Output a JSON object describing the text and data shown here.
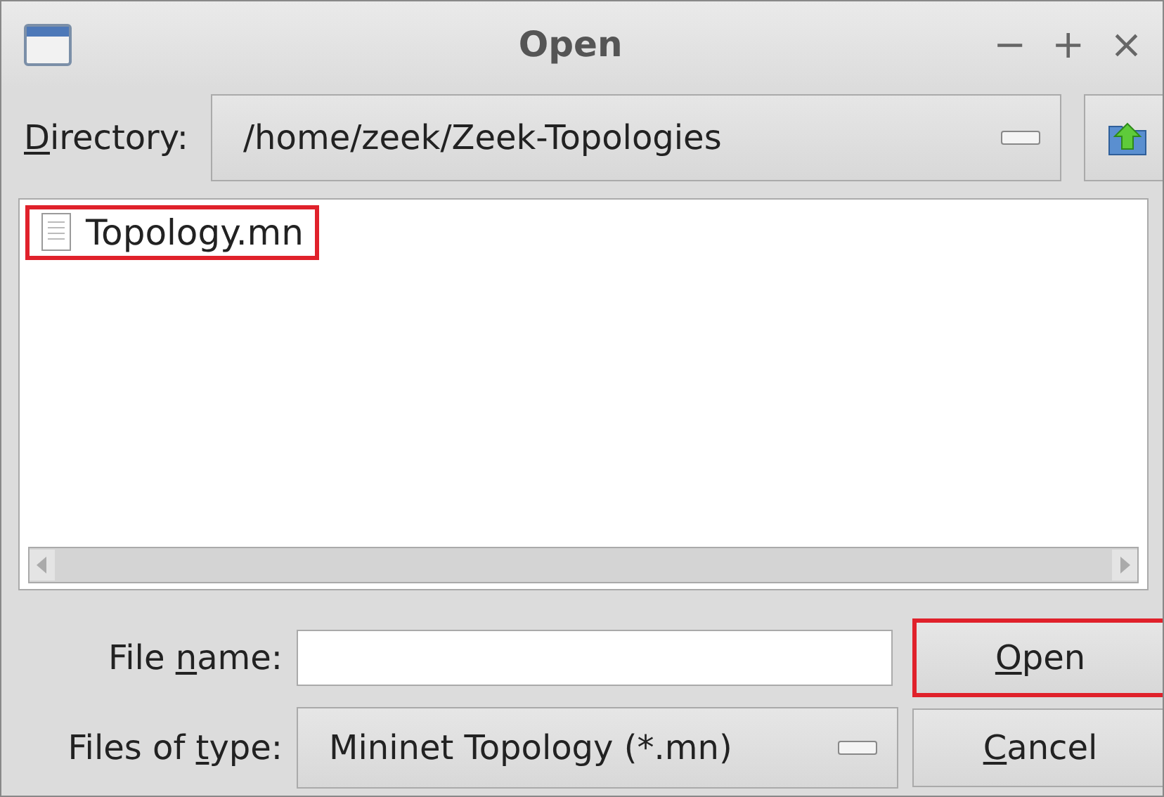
{
  "window": {
    "title": "Open",
    "controls": [
      "−",
      "+",
      "×"
    ]
  },
  "directory": {
    "label": [
      {
        "mnemonic": "D",
        "after": "irectory:"
      }
    ],
    "value": "/home/zeek/Zeek-Topologies"
  },
  "files": [
    {
      "name": "Topology.mn",
      "highlighted": true
    }
  ],
  "file_name": {
    "label": [
      {
        "text": "File ",
        "mnemonic": "n",
        "after": "ame:"
      }
    ]
  },
  "files_of_type": {
    "label": [
      {
        "text": "Files of ",
        "mnemonic": "t",
        "after": "ype:"
      }
    ],
    "value": "Mininet Topology (*.mn)"
  },
  "buttons": [
    {
      "mnemonic": "O",
      "after": "pen",
      "highlighted": true
    },
    {
      "mnemonic": "C",
      "after": "ancel",
      "highlighted": false
    }
  ]
}
